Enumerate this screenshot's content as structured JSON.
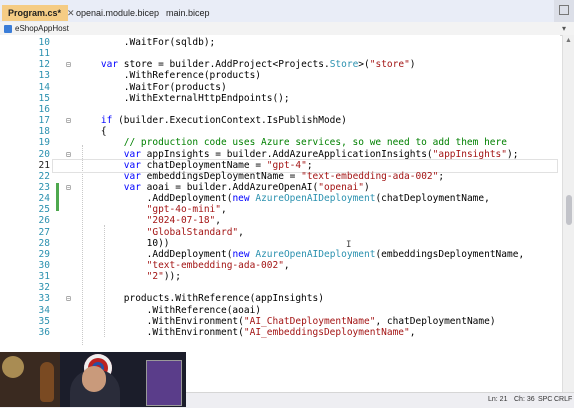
{
  "tabs": [
    {
      "label": "Program.cs*",
      "active": true
    },
    {
      "label": "openai.module.bicep",
      "active": false
    },
    {
      "label": "main.bicep",
      "active": false
    }
  ],
  "navbar": {
    "project": "eShopAppHost"
  },
  "editor": {
    "current_line": 21,
    "lines": [
      {
        "num": "10",
        "tokens": [
          {
            "t": "        .WaitFor(sqldb);",
            "c": "pl"
          }
        ]
      },
      {
        "num": "11",
        "tokens": []
      },
      {
        "num": "12",
        "tokens": [
          {
            "t": "    ",
            "c": "pl"
          },
          {
            "t": "var",
            "c": "kw"
          },
          {
            "t": " store = builder.AddProject<Projects.",
            "c": "pl"
          },
          {
            "t": "Store",
            "c": "ty"
          },
          {
            "t": ">(",
            "c": "pl"
          },
          {
            "t": "\"store\"",
            "c": "st"
          },
          {
            "t": ")",
            "c": "pl"
          }
        ]
      },
      {
        "num": "13",
        "tokens": [
          {
            "t": "        .WithReference(products)",
            "c": "pl"
          }
        ]
      },
      {
        "num": "14",
        "tokens": [
          {
            "t": "        .WaitFor(products)",
            "c": "pl"
          }
        ]
      },
      {
        "num": "15",
        "tokens": [
          {
            "t": "        .WithExternalHttpEndpoints();",
            "c": "pl"
          }
        ]
      },
      {
        "num": "16",
        "tokens": []
      },
      {
        "num": "17",
        "tokens": [
          {
            "t": "    ",
            "c": "pl"
          },
          {
            "t": "if",
            "c": "kw"
          },
          {
            "t": " (builder.ExecutionContext.IsPublishMode)",
            "c": "pl"
          }
        ]
      },
      {
        "num": "18",
        "tokens": [
          {
            "t": "    {",
            "c": "pl"
          }
        ]
      },
      {
        "num": "19",
        "tokens": [
          {
            "t": "        // production code uses Azure services, so we need to add them here",
            "c": "cm"
          }
        ]
      },
      {
        "num": "20",
        "tokens": [
          {
            "t": "        ",
            "c": "pl"
          },
          {
            "t": "var",
            "c": "kw"
          },
          {
            "t": " appInsights = builder.AddAzureApplicationInsights(",
            "c": "pl"
          },
          {
            "t": "\"appInsights\"",
            "c": "st"
          },
          {
            "t": ");",
            "c": "pl"
          }
        ]
      },
      {
        "num": "21",
        "tokens": [
          {
            "t": "        ",
            "c": "pl"
          },
          {
            "t": "var",
            "c": "kw"
          },
          {
            "t": " chatDeploymentName = ",
            "c": "pl"
          },
          {
            "t": "\"gpt-4\"",
            "c": "st"
          },
          {
            "t": ";",
            "c": "pl"
          }
        ]
      },
      {
        "num": "22",
        "tokens": [
          {
            "t": "        ",
            "c": "pl"
          },
          {
            "t": "var",
            "c": "kw"
          },
          {
            "t": " embeddingsDeploymentName = ",
            "c": "pl"
          },
          {
            "t": "\"text-embedding-ada-002\"",
            "c": "st"
          },
          {
            "t": ";",
            "c": "pl"
          }
        ]
      },
      {
        "num": "23",
        "tokens": [
          {
            "t": "        ",
            "c": "pl"
          },
          {
            "t": "var",
            "c": "kw"
          },
          {
            "t": " aoai = builder.AddAzureOpenAI(",
            "c": "pl"
          },
          {
            "t": "\"openai\"",
            "c": "st"
          },
          {
            "t": ")",
            "c": "pl"
          }
        ]
      },
      {
        "num": "24",
        "tokens": [
          {
            "t": "            .AddDeployment(",
            "c": "pl"
          },
          {
            "t": "new",
            "c": "kw"
          },
          {
            "t": " ",
            "c": "pl"
          },
          {
            "t": "AzureOpenAIDeployment",
            "c": "ty"
          },
          {
            "t": "(chatDeploymentName,",
            "c": "pl"
          }
        ]
      },
      {
        "num": "25",
        "tokens": [
          {
            "t": "            ",
            "c": "pl"
          },
          {
            "t": "\"gpt-4o-mini\"",
            "c": "st"
          },
          {
            "t": ",",
            "c": "pl"
          }
        ]
      },
      {
        "num": "26",
        "tokens": [
          {
            "t": "            ",
            "c": "pl"
          },
          {
            "t": "\"2024-07-18\"",
            "c": "st"
          },
          {
            "t": ",",
            "c": "pl"
          }
        ]
      },
      {
        "num": "27",
        "tokens": [
          {
            "t": "            ",
            "c": "pl"
          },
          {
            "t": "\"GlobalStandard\"",
            "c": "st"
          },
          {
            "t": ",",
            "c": "pl"
          }
        ]
      },
      {
        "num": "28",
        "tokens": [
          {
            "t": "            10))",
            "c": "pl"
          }
        ]
      },
      {
        "num": "29",
        "tokens": [
          {
            "t": "            .AddDeployment(",
            "c": "pl"
          },
          {
            "t": "new",
            "c": "kw"
          },
          {
            "t": " ",
            "c": "pl"
          },
          {
            "t": "AzureOpenAIDeployment",
            "c": "ty"
          },
          {
            "t": "(embeddingsDeploymentName,",
            "c": "pl"
          }
        ]
      },
      {
        "num": "30",
        "tokens": [
          {
            "t": "            ",
            "c": "pl"
          },
          {
            "t": "\"text-embedding-ada-002\"",
            "c": "st"
          },
          {
            "t": ",",
            "c": "pl"
          }
        ]
      },
      {
        "num": "31",
        "tokens": [
          {
            "t": "            ",
            "c": "pl"
          },
          {
            "t": "\"2\"",
            "c": "st"
          },
          {
            "t": "));",
            "c": "pl"
          }
        ]
      },
      {
        "num": "32",
        "tokens": []
      },
      {
        "num": "33",
        "tokens": [
          {
            "t": "        products.WithReference(appInsights)",
            "c": "pl"
          }
        ]
      },
      {
        "num": "34",
        "tokens": [
          {
            "t": "            .WithReference(aoai)",
            "c": "pl"
          }
        ]
      },
      {
        "num": "35",
        "tokens": [
          {
            "t": "            .WithEnvironment(",
            "c": "pl"
          },
          {
            "t": "\"AI_ChatDeploymentName\"",
            "c": "st"
          },
          {
            "t": ", chatDeploymentName)",
            "c": "pl"
          }
        ]
      },
      {
        "num": "36",
        "tokens": [
          {
            "t": "            .WithEnvironment(",
            "c": "pl"
          },
          {
            "t": "\"AI_embeddingsDeploymentName\"",
            "c": "st"
          },
          {
            "t": ",",
            "c": "pl"
          }
        ]
      }
    ]
  },
  "statusbar": {
    "ln": "Ln: 21",
    "ch": "Ch: 36",
    "spc": "SPC",
    "crlf": "CRLF"
  },
  "colors": {
    "keyword": "#0000ff",
    "type": "#2b91af",
    "string": "#a31515",
    "comment": "#008000",
    "active_tab": "#f5cc84",
    "line_number": "#2b91af"
  },
  "icons": {
    "project": "csharp-project-icon",
    "tab_close": "close-icon",
    "dropdown": "chevron-down-icon"
  }
}
